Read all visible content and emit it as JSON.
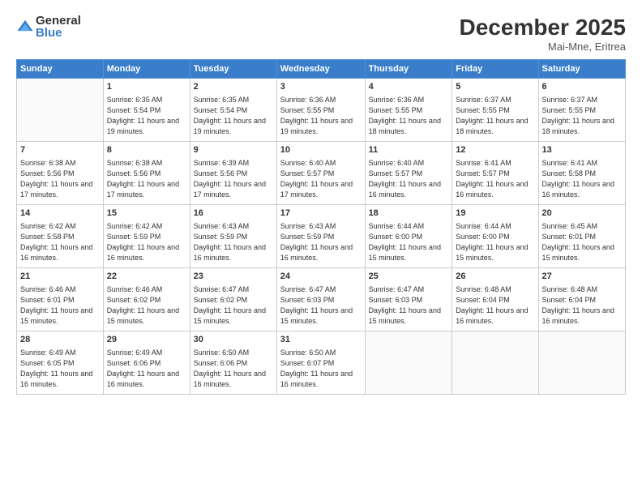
{
  "logo": {
    "general": "General",
    "blue": "Blue"
  },
  "header": {
    "month": "December 2025",
    "location": "Mai-Mne, Eritrea"
  },
  "days": [
    "Sunday",
    "Monday",
    "Tuesday",
    "Wednesday",
    "Thursday",
    "Friday",
    "Saturday"
  ],
  "weeks": [
    [
      {
        "day": "",
        "sunrise": "",
        "sunset": "",
        "daylight": ""
      },
      {
        "day": "1",
        "sunrise": "Sunrise: 6:35 AM",
        "sunset": "Sunset: 5:54 PM",
        "daylight": "Daylight: 11 hours and 19 minutes."
      },
      {
        "day": "2",
        "sunrise": "Sunrise: 6:35 AM",
        "sunset": "Sunset: 5:54 PM",
        "daylight": "Daylight: 11 hours and 19 minutes."
      },
      {
        "day": "3",
        "sunrise": "Sunrise: 6:36 AM",
        "sunset": "Sunset: 5:55 PM",
        "daylight": "Daylight: 11 hours and 19 minutes."
      },
      {
        "day": "4",
        "sunrise": "Sunrise: 6:36 AM",
        "sunset": "Sunset: 5:55 PM",
        "daylight": "Daylight: 11 hours and 18 minutes."
      },
      {
        "day": "5",
        "sunrise": "Sunrise: 6:37 AM",
        "sunset": "Sunset: 5:55 PM",
        "daylight": "Daylight: 11 hours and 18 minutes."
      },
      {
        "day": "6",
        "sunrise": "Sunrise: 6:37 AM",
        "sunset": "Sunset: 5:55 PM",
        "daylight": "Daylight: 11 hours and 18 minutes."
      }
    ],
    [
      {
        "day": "7",
        "sunrise": "Sunrise: 6:38 AM",
        "sunset": "Sunset: 5:56 PM",
        "daylight": "Daylight: 11 hours and 17 minutes."
      },
      {
        "day": "8",
        "sunrise": "Sunrise: 6:38 AM",
        "sunset": "Sunset: 5:56 PM",
        "daylight": "Daylight: 11 hours and 17 minutes."
      },
      {
        "day": "9",
        "sunrise": "Sunrise: 6:39 AM",
        "sunset": "Sunset: 5:56 PM",
        "daylight": "Daylight: 11 hours and 17 minutes."
      },
      {
        "day": "10",
        "sunrise": "Sunrise: 6:40 AM",
        "sunset": "Sunset: 5:57 PM",
        "daylight": "Daylight: 11 hours and 17 minutes."
      },
      {
        "day": "11",
        "sunrise": "Sunrise: 6:40 AM",
        "sunset": "Sunset: 5:57 PM",
        "daylight": "Daylight: 11 hours and 16 minutes."
      },
      {
        "day": "12",
        "sunrise": "Sunrise: 6:41 AM",
        "sunset": "Sunset: 5:57 PM",
        "daylight": "Daylight: 11 hours and 16 minutes."
      },
      {
        "day": "13",
        "sunrise": "Sunrise: 6:41 AM",
        "sunset": "Sunset: 5:58 PM",
        "daylight": "Daylight: 11 hours and 16 minutes."
      }
    ],
    [
      {
        "day": "14",
        "sunrise": "Sunrise: 6:42 AM",
        "sunset": "Sunset: 5:58 PM",
        "daylight": "Daylight: 11 hours and 16 minutes."
      },
      {
        "day": "15",
        "sunrise": "Sunrise: 6:42 AM",
        "sunset": "Sunset: 5:59 PM",
        "daylight": "Daylight: 11 hours and 16 minutes."
      },
      {
        "day": "16",
        "sunrise": "Sunrise: 6:43 AM",
        "sunset": "Sunset: 5:59 PM",
        "daylight": "Daylight: 11 hours and 16 minutes."
      },
      {
        "day": "17",
        "sunrise": "Sunrise: 6:43 AM",
        "sunset": "Sunset: 5:59 PM",
        "daylight": "Daylight: 11 hours and 16 minutes."
      },
      {
        "day": "18",
        "sunrise": "Sunrise: 6:44 AM",
        "sunset": "Sunset: 6:00 PM",
        "daylight": "Daylight: 11 hours and 15 minutes."
      },
      {
        "day": "19",
        "sunrise": "Sunrise: 6:44 AM",
        "sunset": "Sunset: 6:00 PM",
        "daylight": "Daylight: 11 hours and 15 minutes."
      },
      {
        "day": "20",
        "sunrise": "Sunrise: 6:45 AM",
        "sunset": "Sunset: 6:01 PM",
        "daylight": "Daylight: 11 hours and 15 minutes."
      }
    ],
    [
      {
        "day": "21",
        "sunrise": "Sunrise: 6:46 AM",
        "sunset": "Sunset: 6:01 PM",
        "daylight": "Daylight: 11 hours and 15 minutes."
      },
      {
        "day": "22",
        "sunrise": "Sunrise: 6:46 AM",
        "sunset": "Sunset: 6:02 PM",
        "daylight": "Daylight: 11 hours and 15 minutes."
      },
      {
        "day": "23",
        "sunrise": "Sunrise: 6:47 AM",
        "sunset": "Sunset: 6:02 PM",
        "daylight": "Daylight: 11 hours and 15 minutes."
      },
      {
        "day": "24",
        "sunrise": "Sunrise: 6:47 AM",
        "sunset": "Sunset: 6:03 PM",
        "daylight": "Daylight: 11 hours and 15 minutes."
      },
      {
        "day": "25",
        "sunrise": "Sunrise: 6:47 AM",
        "sunset": "Sunset: 6:03 PM",
        "daylight": "Daylight: 11 hours and 15 minutes."
      },
      {
        "day": "26",
        "sunrise": "Sunrise: 6:48 AM",
        "sunset": "Sunset: 6:04 PM",
        "daylight": "Daylight: 11 hours and 16 minutes."
      },
      {
        "day": "27",
        "sunrise": "Sunrise: 6:48 AM",
        "sunset": "Sunset: 6:04 PM",
        "daylight": "Daylight: 11 hours and 16 minutes."
      }
    ],
    [
      {
        "day": "28",
        "sunrise": "Sunrise: 6:49 AM",
        "sunset": "Sunset: 6:05 PM",
        "daylight": "Daylight: 11 hours and 16 minutes."
      },
      {
        "day": "29",
        "sunrise": "Sunrise: 6:49 AM",
        "sunset": "Sunset: 6:06 PM",
        "daylight": "Daylight: 11 hours and 16 minutes."
      },
      {
        "day": "30",
        "sunrise": "Sunrise: 6:50 AM",
        "sunset": "Sunset: 6:06 PM",
        "daylight": "Daylight: 11 hours and 16 minutes."
      },
      {
        "day": "31",
        "sunrise": "Sunrise: 6:50 AM",
        "sunset": "Sunset: 6:07 PM",
        "daylight": "Daylight: 11 hours and 16 minutes."
      },
      {
        "day": "",
        "sunrise": "",
        "sunset": "",
        "daylight": ""
      },
      {
        "day": "",
        "sunrise": "",
        "sunset": "",
        "daylight": ""
      },
      {
        "day": "",
        "sunrise": "",
        "sunset": "",
        "daylight": ""
      }
    ]
  ]
}
